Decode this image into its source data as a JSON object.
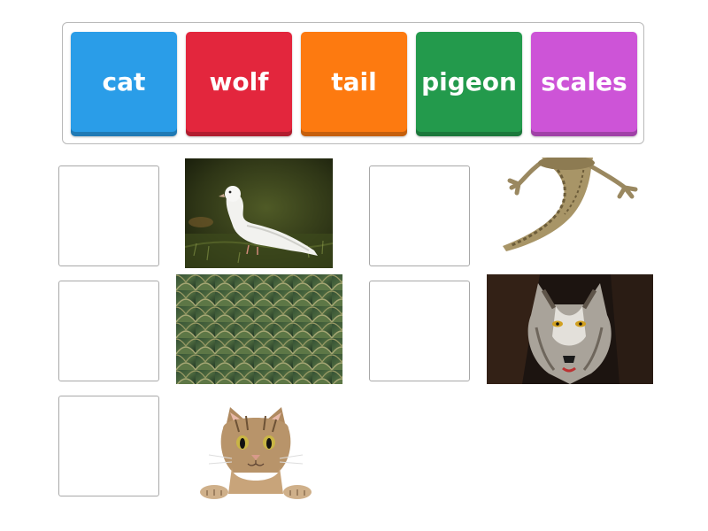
{
  "word_bank": {
    "tiles": [
      {
        "label": "cat",
        "color": "#2a9de8"
      },
      {
        "label": "wolf",
        "color": "#e3263d"
      },
      {
        "label": "tail",
        "color": "#fd7a10"
      },
      {
        "label": "pigeon",
        "color": "#239a4c"
      },
      {
        "label": "scales",
        "color": "#cd54d7"
      }
    ]
  },
  "answer_slots": {
    "slot1_value": "",
    "slot2_value": "",
    "slot3_value": "",
    "slot4_value": "",
    "slot5_value": ""
  },
  "images": [
    {
      "subject": "white pigeon on grass"
    },
    {
      "subject": "reptile tail"
    },
    {
      "subject": "fish scales"
    },
    {
      "subject": "wolf face"
    },
    {
      "subject": "tabby cat peeking"
    }
  ]
}
